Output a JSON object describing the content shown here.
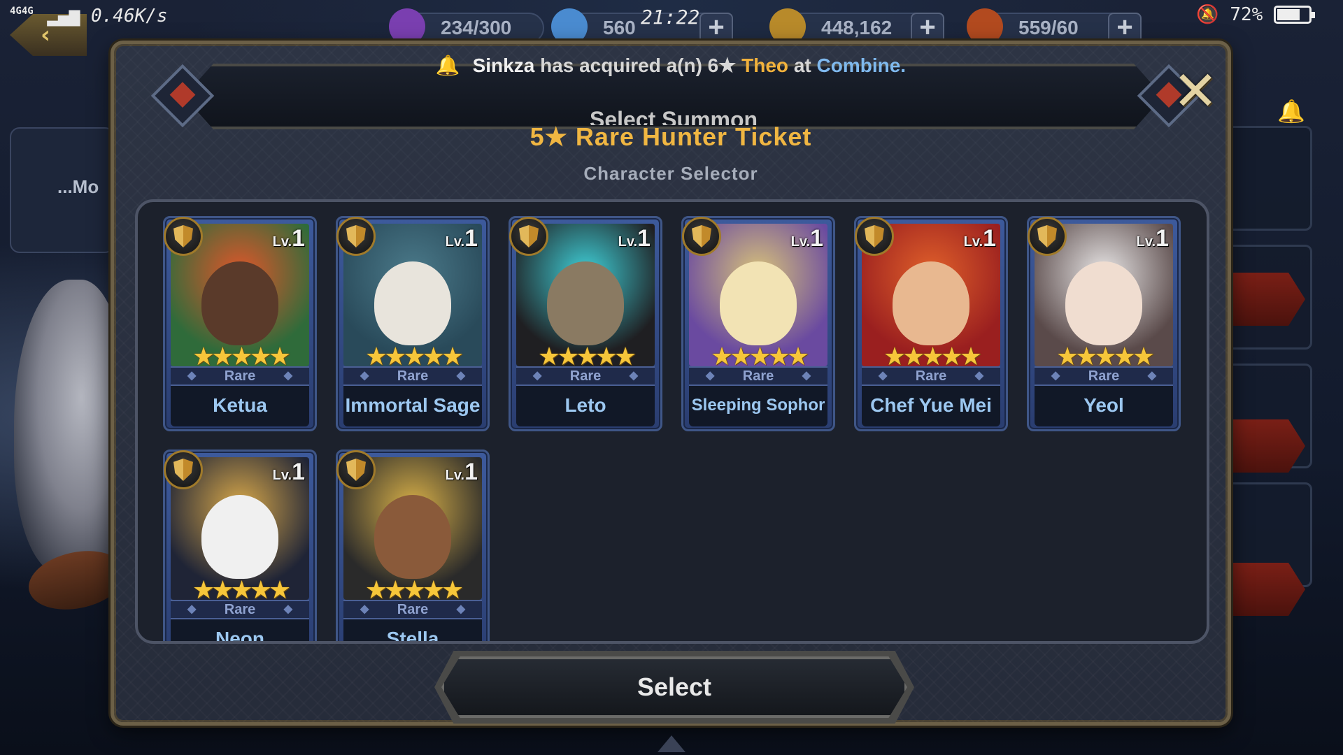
{
  "status_bar": {
    "network": "4G4G",
    "speed": "0.46K/s",
    "time": "21:22",
    "battery": "72%",
    "battery_level": 0.72
  },
  "resources": [
    {
      "value": "234/300",
      "color": "#7a3fb0"
    },
    {
      "value": "560",
      "color": "#4a8bd0"
    },
    {
      "value": "448,162",
      "color": "#b88a2a"
    },
    {
      "value": "559/60",
      "color": "#b24a1f"
    }
  ],
  "background": {
    "left_chip_text": "...Mo"
  },
  "notice": {
    "player": "Sinkza",
    "text_1": "has acquired a(n) 6★",
    "hero": "Theo",
    "text_2": "at",
    "place": "Combine."
  },
  "popup": {
    "hidden_title": "Select Summon",
    "title": "5★ Rare Hunter Ticket",
    "subtitle": "Character Selector",
    "close_label": "✕",
    "select_label": "Select"
  },
  "cards": [
    {
      "name": "Ketua",
      "level": "1",
      "rarity": "Rare",
      "stars": "★★★★★",
      "bg": "#2f6b3a",
      "face": "#5a3a2a",
      "accent": "#e0562a"
    },
    {
      "name": "Immortal Sage",
      "level": "1",
      "rarity": "Rare",
      "stars": "★★★★★",
      "bg": "#294a5a",
      "face": "#e8e4dc",
      "accent": "#4b7a8a"
    },
    {
      "name": "Leto",
      "level": "1",
      "rarity": "Rare",
      "stars": "★★★★★",
      "bg": "#1f1f22",
      "face": "#8a7a62",
      "accent": "#3fd0d8"
    },
    {
      "name": "Sleeping Sophor",
      "level": "1",
      "rarity": "Rare",
      "stars": "★★★★★",
      "bg": "#6a4aa0",
      "face": "#f2e3b4",
      "accent": "#d8c27a"
    },
    {
      "name": "Chef Yue Mei",
      "level": "1",
      "rarity": "Rare",
      "stars": "★★★★★",
      "bg": "#9a1f1f",
      "face": "#e8b890",
      "accent": "#e0602a"
    },
    {
      "name": "Yeol",
      "level": "1",
      "rarity": "Rare",
      "stars": "★★★★★",
      "bg": "#5a4a4a",
      "face": "#f0ddd0",
      "accent": "#e8e6e6"
    },
    {
      "name": "Neon",
      "level": "1",
      "rarity": "Rare",
      "stars": "★★★★★",
      "bg": "#1f2436",
      "face": "#f0f0f0",
      "accent": "#d8a84a"
    },
    {
      "name": "Stella",
      "level": "1",
      "rarity": "Rare",
      "stars": "★★★★★",
      "bg": "#2a2a2a",
      "face": "#8a5a3a",
      "accent": "#d8b048"
    }
  ]
}
